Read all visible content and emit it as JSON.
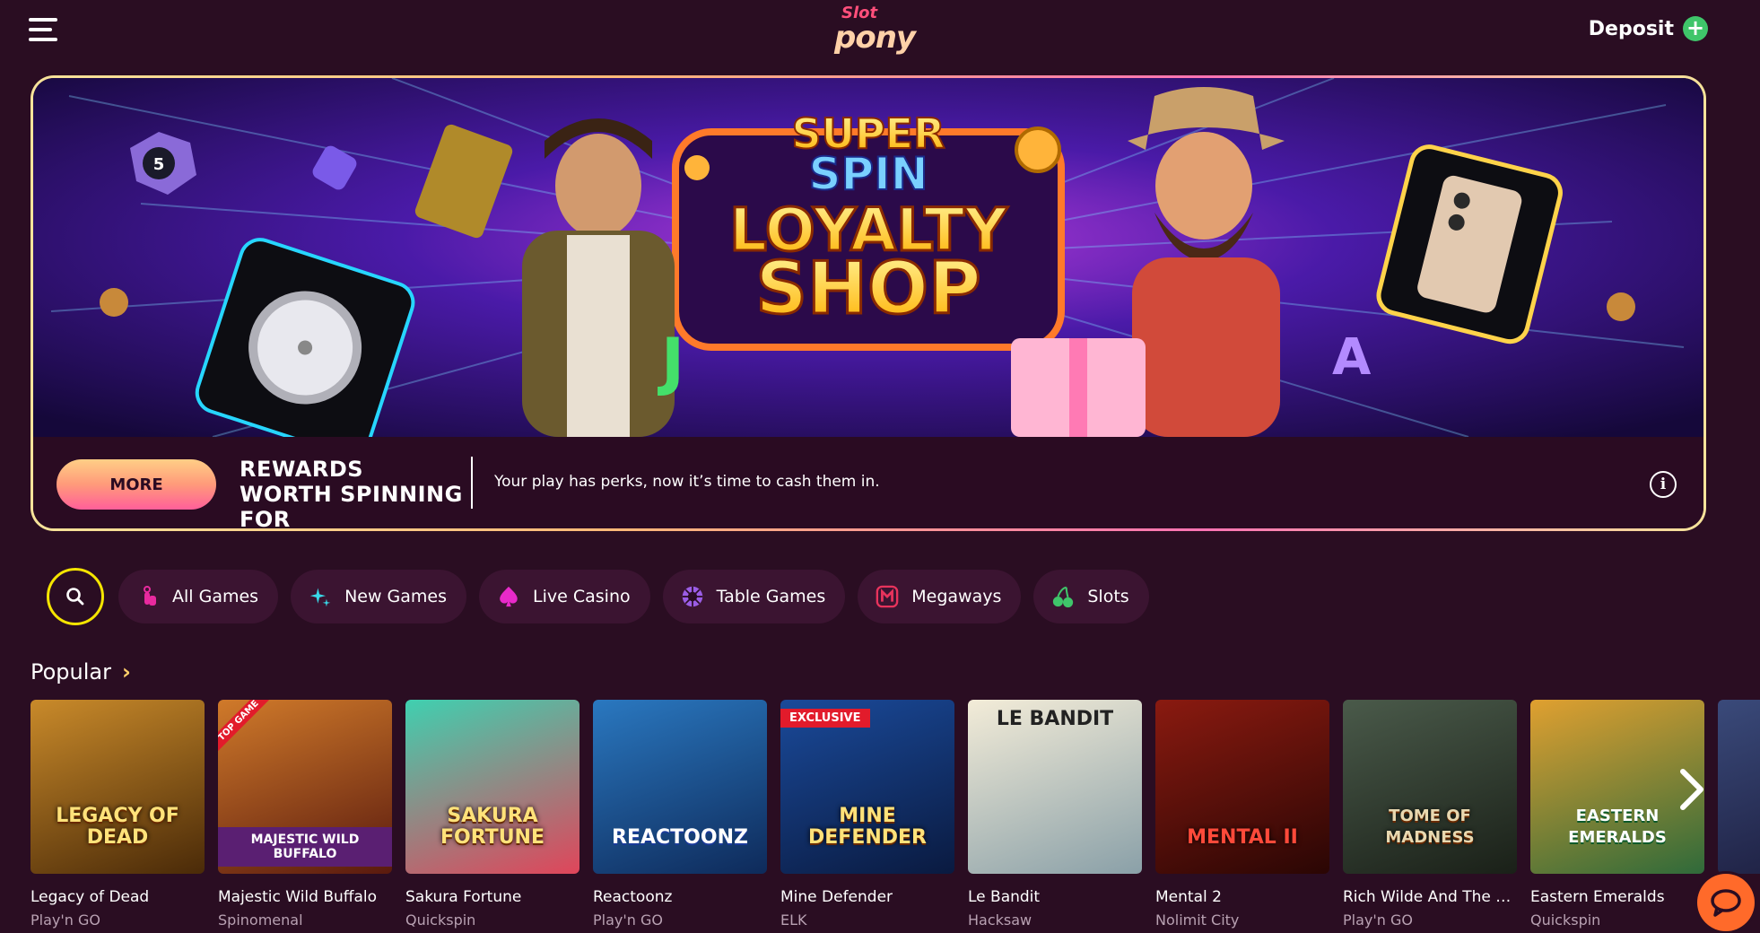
{
  "header": {
    "logo_line1": "Slot",
    "logo_line2": "pony",
    "deposit_label": "Deposit"
  },
  "banner": {
    "art_title_1": "SUPER",
    "art_title_2": "SPIN",
    "art_title_3": "LOYALTY",
    "art_title_4": "SHOP",
    "more_label": "MORE",
    "title": "REWARDS WORTH SPINNING FOR",
    "description": "Your play has perks, now it’s time to cash them in."
  },
  "categories": [
    {
      "label": "All Games",
      "icon": "hand-tap-icon",
      "color": "#e82a9e"
    },
    {
      "label": "New Games",
      "icon": "sparkles-icon",
      "color": "#39d9e8"
    },
    {
      "label": "Live Casino",
      "icon": "spade-icon",
      "color": "#e82ac9"
    },
    {
      "label": "Table Games",
      "icon": "roulette-icon",
      "color": "#9b5de5"
    },
    {
      "label": "Megaways",
      "icon": "megaways-icon",
      "color": "#e8335c"
    },
    {
      "label": "Slots",
      "icon": "cherries-icon",
      "color": "#3fc56a"
    }
  ],
  "popular": {
    "title": "Popular",
    "games": [
      {
        "name": "Legacy of Dead",
        "provider": "Play'n GO",
        "thumb_text": "LEGACY OF DEAD",
        "bg": "#7a4a10"
      },
      {
        "name": "Majestic Wild Buffalo",
        "provider": "Spinomenal",
        "thumb_text": "MAJESTIC WILD BUFFALO",
        "badge": "TOP GAME",
        "bg": "#6b2a14"
      },
      {
        "name": "Sakura Fortune",
        "provider": "Quickspin",
        "thumb_text": "SAKURA FORTUNE",
        "bg": "#2eb89a"
      },
      {
        "name": "Reactoonz",
        "provider": "Play'n GO",
        "thumb_text": "REACTOONZ",
        "bg": "#1c4f8a"
      },
      {
        "name": "Mine Defender",
        "provider": "ELK",
        "thumb_text": "MINE DEFENDER",
        "badge": "EXCLUSIVE",
        "bg": "#123a78"
      },
      {
        "name": "Le Bandit",
        "provider": "Hacksaw",
        "thumb_text": "LE BANDIT",
        "bg": "#e8e0c8"
      },
      {
        "name": "Mental 2",
        "provider": "Nolimit City",
        "thumb_text": "MENTAL II",
        "bg": "#5a0f0a"
      },
      {
        "name": "Rich Wilde And The To...",
        "provider": "Play'n GO",
        "thumb_text": "TOME OF MADNESS",
        "bg": "#2c3a33"
      },
      {
        "name": "Eastern Emeralds",
        "provider": "Quickspin",
        "thumb_text": "EASTERN EMERALDS",
        "bg": "#2f7a3a"
      }
    ]
  }
}
